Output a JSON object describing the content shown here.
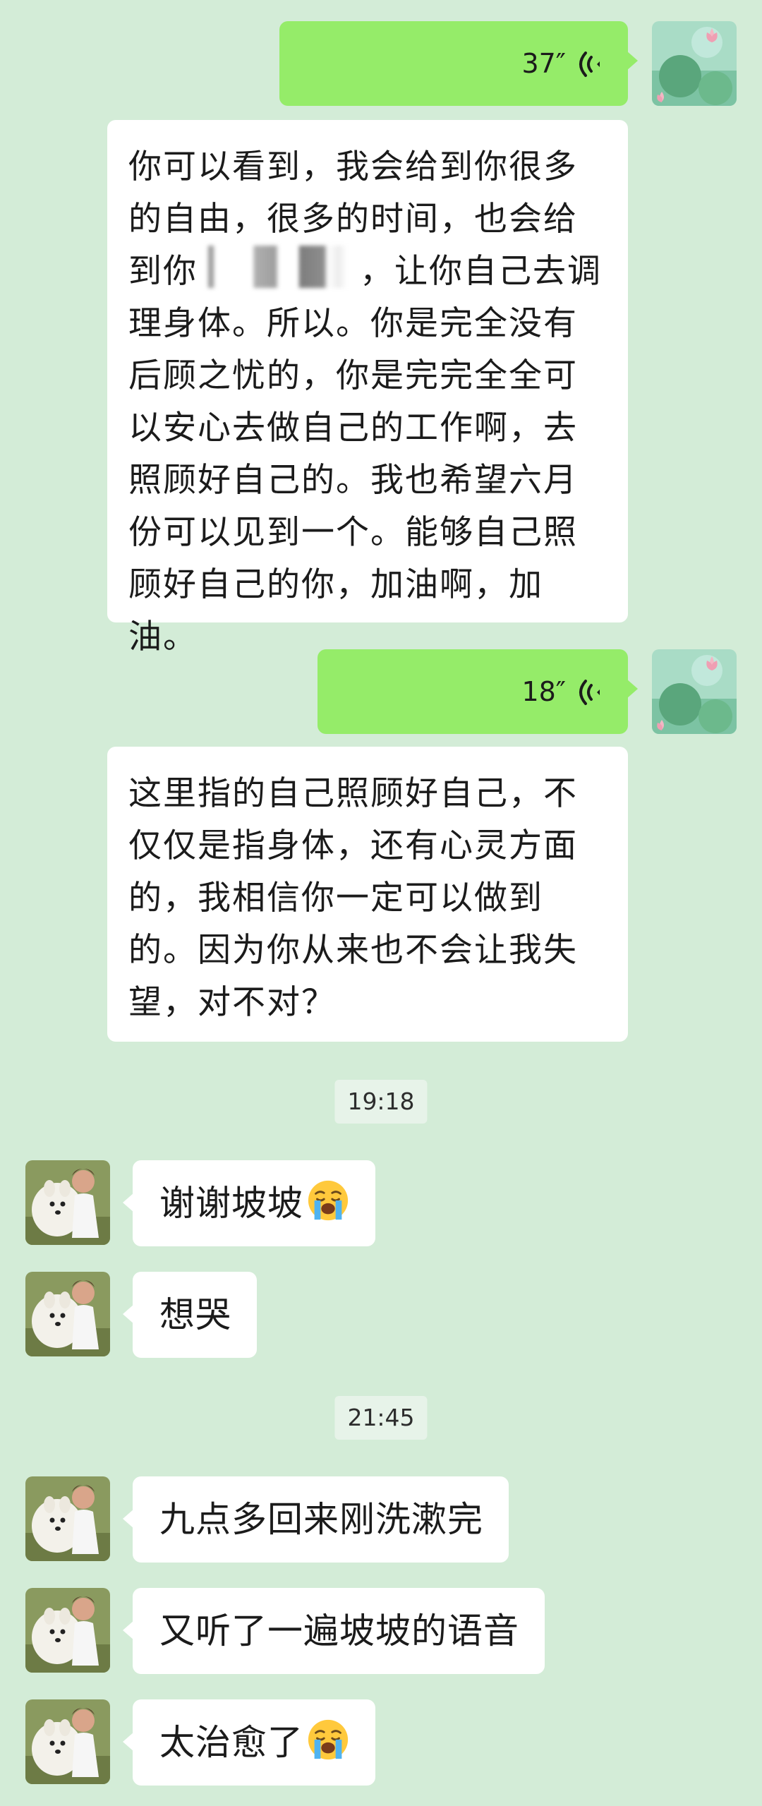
{
  "messages": {
    "voice1": {
      "duration": "37″"
    },
    "transcript1": {
      "part1": "你可以看到，我会给到你很多的自由，很多的时间，也会给到你",
      "part2": "，让你自己去调理身体。所以。你是完全没有后顾之忧的，你是完完全全可以安心去做自己的工作啊，去照顾好自己的。我也希望六月份可以见到一个。能够自己照顾好自己的你，加油啊，加油。"
    },
    "voice2": {
      "duration": "18″"
    },
    "transcript2": {
      "text": "这里指的自己照顾好自己，不仅仅是指身体，还有心灵方面的，我相信你一定可以做到的。因为你从来也不会让我失望，对不对？"
    },
    "time1": "19:18",
    "in1": {
      "text": "谢谢坡坡",
      "emoji": "loudly-crying-face"
    },
    "in2": {
      "text": "想哭"
    },
    "time2": "21:45",
    "in3": {
      "text": "九点多回来刚洗漱完"
    },
    "in4": {
      "text": "又听了一遍坡坡的语音"
    },
    "in5": {
      "text": "太治愈了",
      "emoji": "loudly-crying-face"
    }
  },
  "colors": {
    "background": "#d3ecd7",
    "outgoing_bubble": "#95ec69",
    "incoming_bubble": "#ffffff",
    "timestamp_bg": "#e7f3e9"
  }
}
